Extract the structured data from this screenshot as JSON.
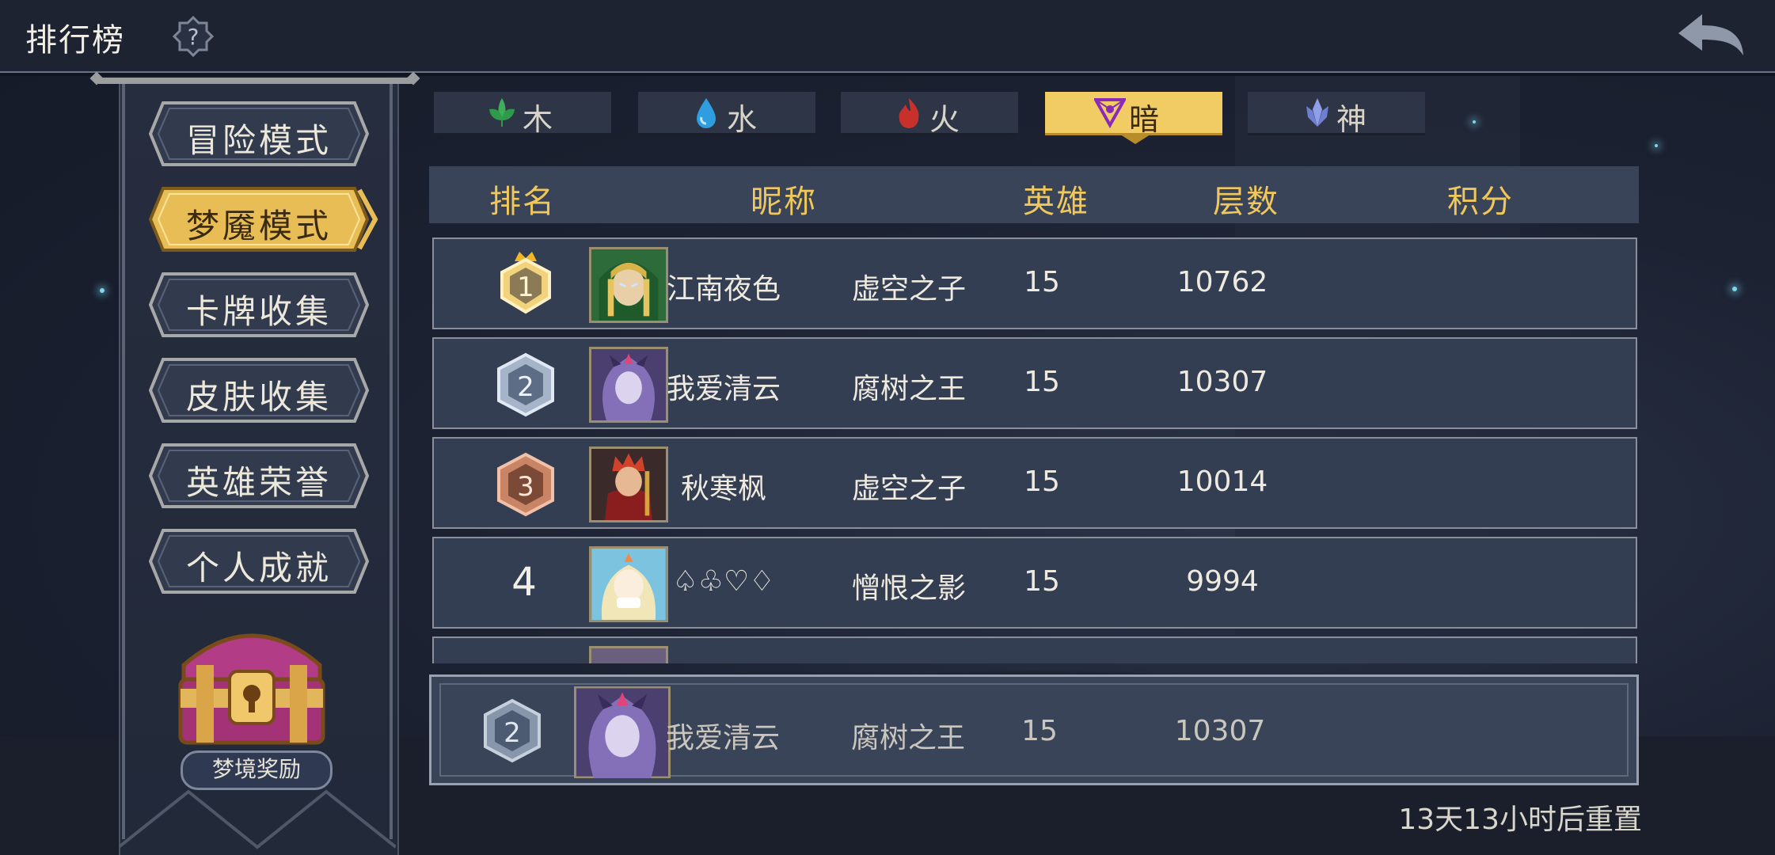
{
  "header": {
    "title": "排行榜",
    "help_icon": "question-gear-icon",
    "back_icon": "back-arrow-icon"
  },
  "sidebar": {
    "modes": [
      {
        "label": "冒险模式",
        "active": false
      },
      {
        "label": "梦魇模式",
        "active": true
      },
      {
        "label": "卡牌收集",
        "active": false
      },
      {
        "label": "皮肤收集",
        "active": false
      },
      {
        "label": "英雄荣誉",
        "active": false
      },
      {
        "label": "个人成就",
        "active": false
      }
    ],
    "reward_label": "梦境奖励"
  },
  "tabs": [
    {
      "label": "木",
      "icon": "leaf-icon",
      "color": "#3fae5a",
      "active": false
    },
    {
      "label": "水",
      "icon": "water-drop-icon",
      "color": "#2f9ee0",
      "active": false
    },
    {
      "label": "火",
      "icon": "flame-icon",
      "color": "#c7302b",
      "active": false
    },
    {
      "label": "暗",
      "icon": "dark-triangle-icon",
      "color": "#8a2bb8",
      "active": true
    },
    {
      "label": "神",
      "icon": "divine-crystal-icon",
      "color": "#8fa0e8",
      "active": false
    }
  ],
  "table": {
    "headers": {
      "rank": "排名",
      "nickname": "昵称",
      "hero": "英雄",
      "floors": "层数",
      "score": "积分"
    },
    "rows": [
      {
        "rank": "1",
        "nickname": "江南夜色",
        "hero": "虚空之子",
        "floors": "15",
        "score": "10762"
      },
      {
        "rank": "2",
        "nickname": "我爱清云",
        "hero": "腐树之王",
        "floors": "15",
        "score": "10307"
      },
      {
        "rank": "3",
        "nickname": "秋寒枫",
        "hero": "虚空之子",
        "floors": "15",
        "score": "10014"
      },
      {
        "rank": "4",
        "nickname": "♤♧♡♢",
        "hero": "憎恨之影",
        "floors": "15",
        "score": "9994"
      }
    ]
  },
  "my_rank": {
    "rank": "2",
    "nickname": "我爱清云",
    "hero": "腐树之王",
    "floors": "15",
    "score": "10307"
  },
  "reset_text": "13天13小时后重置"
}
